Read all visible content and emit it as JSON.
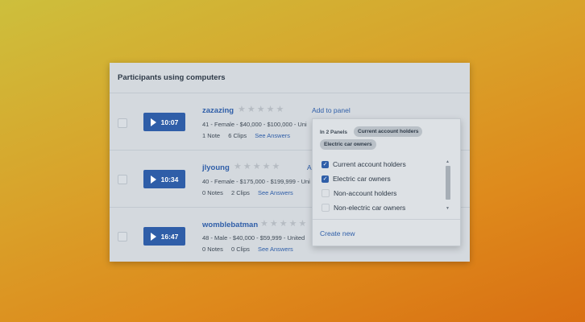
{
  "card": {
    "title": "Participants using computers"
  },
  "rows": [
    {
      "duration": "10:07",
      "name": "zazazing",
      "demographics": "41 - Female - $40,000 - $100,000 - Uni",
      "notes": "1 Note",
      "clips": "6 Clips",
      "answers": "See Answers",
      "add_label": "Add to panel"
    },
    {
      "duration": "10:34",
      "name": "jlyoung",
      "demographics": "40 - Female - $175,000 - $199,999 - Uni",
      "notes": "0 Notes",
      "clips": "2 Clips",
      "answers": "See Answers",
      "add_label": "A"
    },
    {
      "duration": "16:47",
      "name": "womblebatman",
      "demographics": "48 - Male - $40,000 - $59,999 - United",
      "notes": "0 Notes",
      "clips": "0 Clips",
      "answers": "See Answers"
    }
  ],
  "rating": {
    "max_stars": 5,
    "filled": 0
  },
  "dropdown": {
    "in_panels_label": "In 2 Panels",
    "panel_tags": [
      "Current account holders",
      "Electric car owners"
    ],
    "options": [
      {
        "label": "Current account holders",
        "checked": true
      },
      {
        "label": "Electric car owners",
        "checked": true
      },
      {
        "label": "Non-account holders",
        "checked": false
      },
      {
        "label": "Non-electric car owners",
        "checked": false
      }
    ],
    "create_new": "Create new"
  },
  "colors": {
    "accent": "#2f5ea8",
    "card_bg": "#d4d9de"
  }
}
